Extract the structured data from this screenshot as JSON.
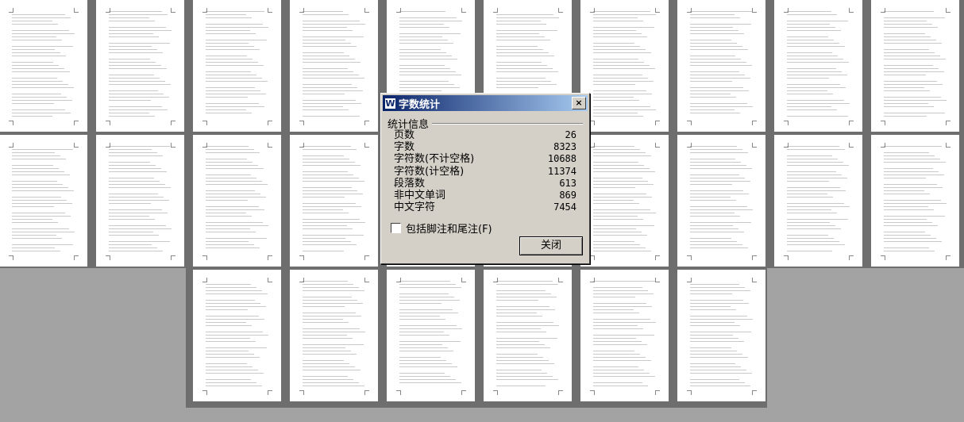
{
  "dialog": {
    "title": "字数统计",
    "close_icon": "×",
    "app_icon": "W",
    "group_label": "统计信息",
    "stats": [
      {
        "label": "页数",
        "value": "26"
      },
      {
        "label": "字数",
        "value": "8323"
      },
      {
        "label": "字符数(不计空格)",
        "value": "10688"
      },
      {
        "label": "字符数(计空格)",
        "value": "11374"
      },
      {
        "label": "段落数",
        "value": "613"
      },
      {
        "label": "非中文单词",
        "value": "869"
      },
      {
        "label": "中文字符",
        "value": "7454"
      }
    ],
    "checkbox_label": "包括脚注和尾注(F)",
    "checkbox_checked": false,
    "close_button": "关闭"
  },
  "document": {
    "page_count_shown": 26
  }
}
